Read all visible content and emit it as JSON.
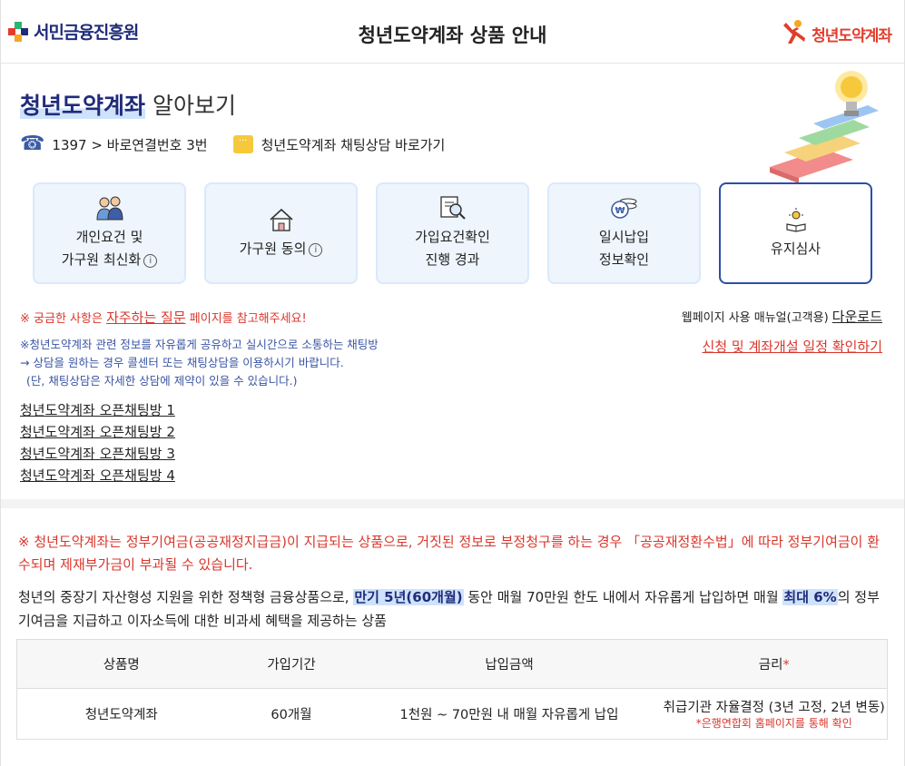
{
  "header": {
    "left_logo_text": "서민금융진흥원",
    "title": "청년도약계좌 상품 안내",
    "right_logo_text": "청년도약계좌"
  },
  "intro": {
    "heading_highlight": "청년도약계좌",
    "heading_rest": "알아보기",
    "phone_text": "1397 > 바로연결번호 3번",
    "chat_text": "청년도약계좌 채팅상담 바로가기"
  },
  "cards": [
    {
      "icon": "people-icon",
      "line1": "개인요건 및",
      "line2": "가구원 최신화",
      "info": true,
      "active": false
    },
    {
      "icon": "house-icon",
      "line1": "가구원 동의",
      "line2": "",
      "info": true,
      "active": false
    },
    {
      "icon": "search-document-icon",
      "line1": "가입요건확인",
      "line2": "진행 경과",
      "info": false,
      "active": false
    },
    {
      "icon": "coins-icon",
      "line1": "일시납입",
      "line2": "정보확인",
      "info": false,
      "active": false
    },
    {
      "icon": "lamp-book-icon",
      "line1": "유지심사",
      "line2": "",
      "info": false,
      "active": true
    }
  ],
  "notices": {
    "faq_prefix": "※ 궁금한 사항은 ",
    "faq_link": "자주하는 질문",
    "faq_suffix": " 페이지를 참고해주세요!",
    "manual_prefix": "웹페이지 사용 매뉴얼(고객용) ",
    "manual_link": "다운로드",
    "schedule_link": "신청 및 계좌개설 일정 확인하기",
    "chat_line1": "※청년도약계좌 관련 정보를 자유롭게 공유하고 실시간으로 소통하는 채팅방",
    "chat_line2": "→ 상담을 원하는 경우 콜센터 또는 채팅상담을 이용하시기 바랍니다.",
    "chat_line3": "(단, 채팅상담은 자세한 상담에 제약이 있을 수 있습니다.)"
  },
  "open_chats": [
    "청년도약계좌 오픈채팅방 1",
    "청년도약계좌 오픈채팅방 2",
    "청년도약계좌 오픈채팅방 3",
    "청년도약계좌 오픈채팅방 4"
  ],
  "warning": "※ 청년도약계좌는 정부기여금(공공재정지급금)이 지급되는 상품으로, 거짓된 정보로 부정청구를 하는 경우 「공공재정환수법」에 따라 정부기여금이 환수되며 제재부가금이 부과될 수 있습니다.",
  "description": {
    "part1": "청년의 중장기 자산형성 지원을 위한 정책형 금융상품으로, ",
    "hl1": "만기 5년(60개월)",
    "part2": " 동안 매월 70만원 한도 내에서 자유롭게 납입하면 매월 ",
    "hl2": "최대 6%",
    "part3": "의 정부기여금을 지급하고 이자소득에 대한 비과세 혜택을 제공하는 상품"
  },
  "table": {
    "headers": [
      "상품명",
      "가입기간",
      "납입금액",
      "금리"
    ],
    "rate_star": "*",
    "row": [
      "청년도약계좌",
      "60개월",
      "1천원 ~ 70만원 내 매월 자유롭게 납입",
      "취급기관 자율결정 (3년 고정, 2년 변동)"
    ],
    "rate_note": "*은행연합회 홈페이지를 통해 확인"
  },
  "colors": {
    "brand_navy": "#1f2c7a",
    "accent_red": "#d9362b",
    "card_bg": "#eef5fd",
    "active_border": "#2a4fa8"
  }
}
